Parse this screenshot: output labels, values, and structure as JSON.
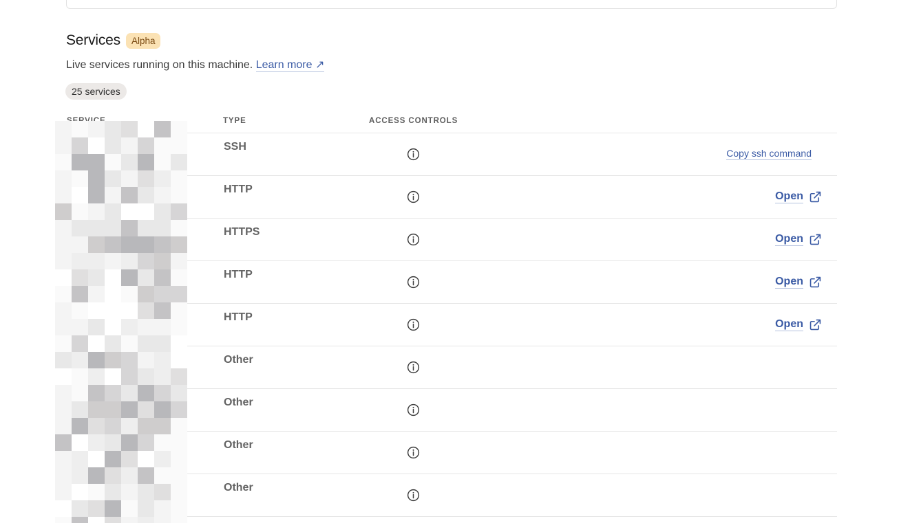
{
  "section": {
    "title": "Services",
    "badge": "Alpha",
    "description": "Live services running on this machine.",
    "learn_more": "Learn more ↗",
    "count": "25 services"
  },
  "table": {
    "columns": {
      "service": "SERVICE",
      "type": "TYPE",
      "access": "ACCESS CONTROLS"
    },
    "rows": [
      {
        "type": "SSH",
        "action": "Copy ssh command",
        "action_kind": "copy"
      },
      {
        "type": "HTTP",
        "action": "Open",
        "action_kind": "open"
      },
      {
        "type": "HTTPS",
        "action": "Open",
        "action_kind": "open"
      },
      {
        "type": "HTTP",
        "action": "Open",
        "action_kind": "open"
      },
      {
        "type": "HTTP",
        "action": "Open",
        "action_kind": "open"
      },
      {
        "type": "Other",
        "action": "",
        "action_kind": "none"
      },
      {
        "type": "Other",
        "action": "",
        "action_kind": "none"
      },
      {
        "type": "Other",
        "action": "",
        "action_kind": "none"
      },
      {
        "type": "Other",
        "action": "",
        "action_kind": "none"
      }
    ]
  },
  "icons": {
    "access": "info-circle-icon",
    "open": "external-link-icon"
  },
  "colors": {
    "link": "#3b5ba5",
    "badge_bg": "#fbe2b4",
    "badge_text": "#7a4a12",
    "count_bg": "#ece9e7"
  }
}
